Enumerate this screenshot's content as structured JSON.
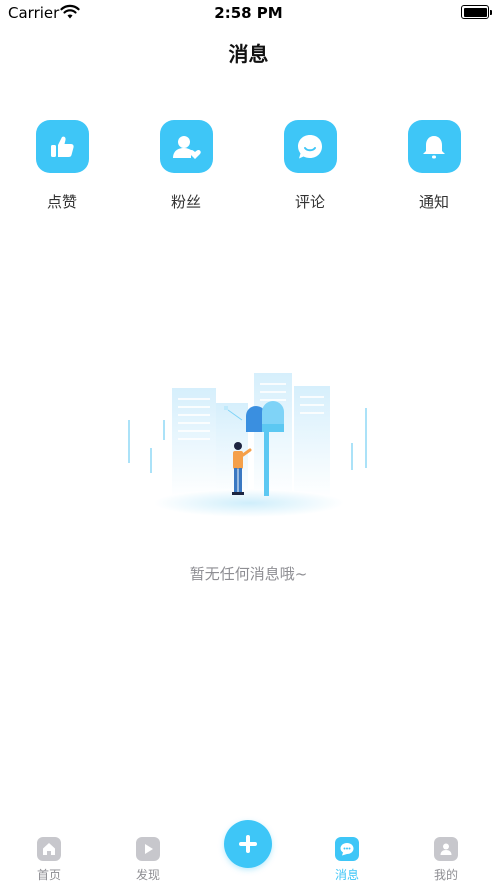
{
  "status_bar": {
    "carrier": "Carrier",
    "time": "2:58 PM"
  },
  "header": {
    "title": "消息"
  },
  "categories": [
    {
      "label": "点赞",
      "icon": "thumbs-up-icon"
    },
    {
      "label": "粉丝",
      "icon": "fans-icon"
    },
    {
      "label": "评论",
      "icon": "comment-icon"
    },
    {
      "label": "通知",
      "icon": "bell-icon"
    }
  ],
  "empty_state": {
    "message": "暂无任何消息哦~",
    "illustration": "mailbox-city-illustration"
  },
  "tab_bar": {
    "items": [
      {
        "label": "首页",
        "icon": "home-icon",
        "active": false
      },
      {
        "label": "发现",
        "icon": "play-icon",
        "active": false
      },
      {
        "label": "消息",
        "icon": "message-icon",
        "active": true
      },
      {
        "label": "我的",
        "icon": "profile-icon",
        "active": false
      }
    ],
    "add_icon": "plus-icon"
  },
  "colors": {
    "accent": "#3ec6f7",
    "inactive": "#c7c7cc",
    "muted_text": "#8e8e93"
  }
}
